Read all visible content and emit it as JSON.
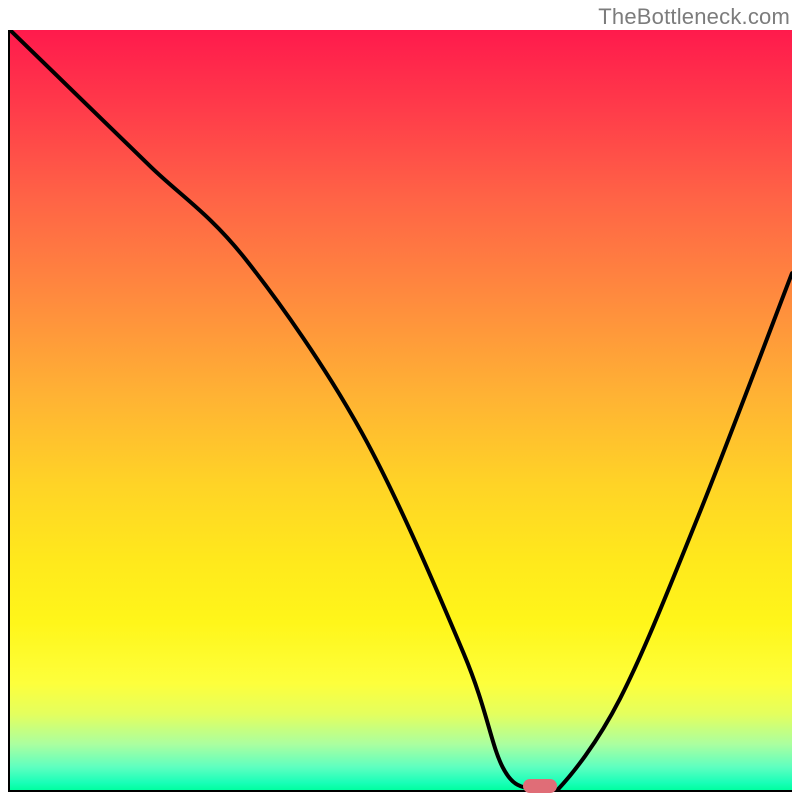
{
  "watermark": "TheBottleneck.com",
  "colors": {
    "axis": "#000000",
    "curve": "#000000",
    "marker": "#e06d77",
    "watermark": "#7c7c7c"
  },
  "chart_data": {
    "type": "line",
    "title": "",
    "xlabel": "",
    "ylabel": "",
    "xlim": [
      0,
      100
    ],
    "ylim": [
      0,
      100
    ],
    "grid": false,
    "series": [
      {
        "name": "bottleneck-v-curve",
        "x": [
          0,
          8,
          18,
          30,
          45,
          58,
          63,
          67,
          70,
          78,
          88,
          100
        ],
        "values": [
          100,
          92,
          82,
          70,
          47,
          18,
          3,
          0,
          0,
          12,
          36,
          68
        ]
      }
    ],
    "marker": {
      "x": 68,
      "y": 0
    }
  }
}
